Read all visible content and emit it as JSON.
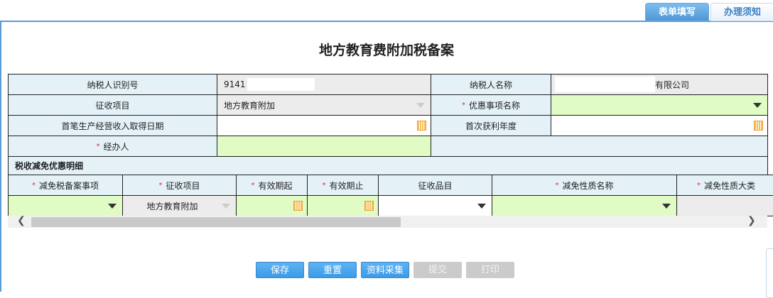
{
  "tabs": [
    {
      "label": "表单填写",
      "active": true
    },
    {
      "label": "办理须知",
      "active": false
    }
  ],
  "title": "地方教育费附加税备案",
  "form": {
    "taxpayer_id_label": "纳税人识别号",
    "taxpayer_id_value": "9141",
    "taxpayer_name_label": "纳税人名称",
    "taxpayer_name_value": "有限公司",
    "levy_item_label": "征收项目",
    "levy_item_value": "地方教育附加",
    "preference_name_label": "优惠事项名称",
    "preference_name_value": "",
    "first_income_date_label": "首笔生产经营收入取得日期",
    "first_income_date_value": "",
    "first_profit_year_label": "首次获利年度",
    "first_profit_year_value": "",
    "handler_label": "经办人",
    "handler_value": ""
  },
  "detail": {
    "section_title": "税收减免优惠明细",
    "columns": [
      "减免税备案事项",
      "征收项目",
      "有效期起",
      "有效期止",
      "征收品目",
      "减免性质名称",
      "减免性质大类"
    ],
    "required": [
      true,
      true,
      true,
      true,
      false,
      true,
      true
    ],
    "row": {
      "levy_item": "地方教育附加"
    }
  },
  "required_mark": "*",
  "buttons": [
    {
      "label": "保存",
      "enabled": true
    },
    {
      "label": "重置",
      "enabled": true
    },
    {
      "label": "资料采集",
      "enabled": true
    },
    {
      "label": "提交",
      "enabled": false
    },
    {
      "label": "打印",
      "enabled": false
    }
  ],
  "colors": {
    "accent": "#5b9bd5",
    "required_bg": "#e0fbc3",
    "label_bg": "#e4f2f8",
    "readonly_bg": "#ececec"
  }
}
